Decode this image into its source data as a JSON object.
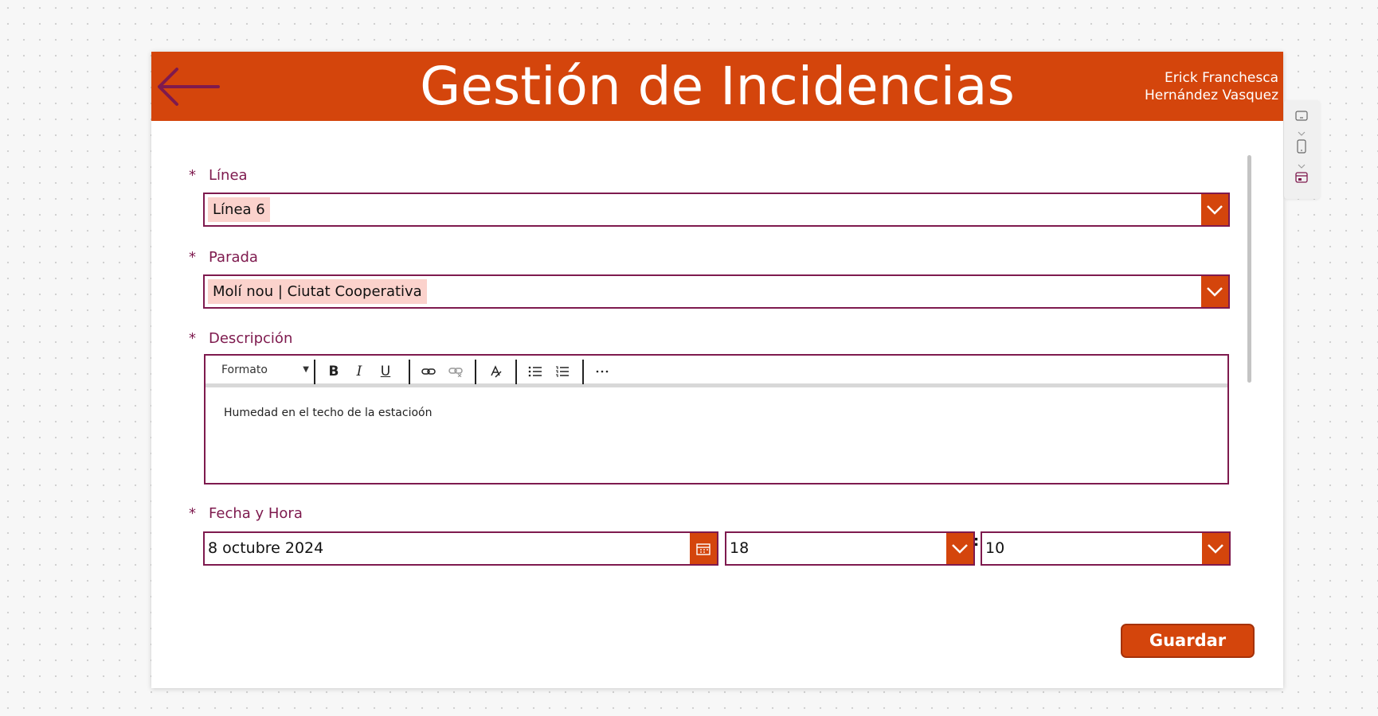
{
  "header": {
    "title": "Gestión de Incidencias",
    "user_line1": "Erick Franchesca",
    "user_line2": "Hernández Vasquez",
    "back_icon": "arrow-left-icon",
    "color": "#d4450c"
  },
  "form": {
    "required_mark": "*",
    "linea": {
      "label": "Línea",
      "value": "Línea 6"
    },
    "parada": {
      "label": "Parada",
      "value": "Molí nou | Ciutat Cooperativa"
    },
    "descripcion": {
      "label": "Descripción",
      "toolbar": {
        "format_label": "Formato",
        "buttons": [
          "bold-icon",
          "italic-icon",
          "underline-icon",
          "link-icon",
          "unlink-icon",
          "clear-format-icon",
          "bullet-list-icon",
          "numbered-list-icon",
          "more-icon"
        ]
      },
      "value": "Humedad en el techo de la estacioón"
    },
    "fecha_hora": {
      "label": "Fecha y Hora",
      "date": "8 octubre 2024",
      "hour": "18",
      "separator": ":",
      "minute": "10"
    },
    "save_label": "Guardar"
  },
  "colors": {
    "accent": "#d4450c",
    "label": "#7e1a4e",
    "chip": "#fbd2cc"
  }
}
